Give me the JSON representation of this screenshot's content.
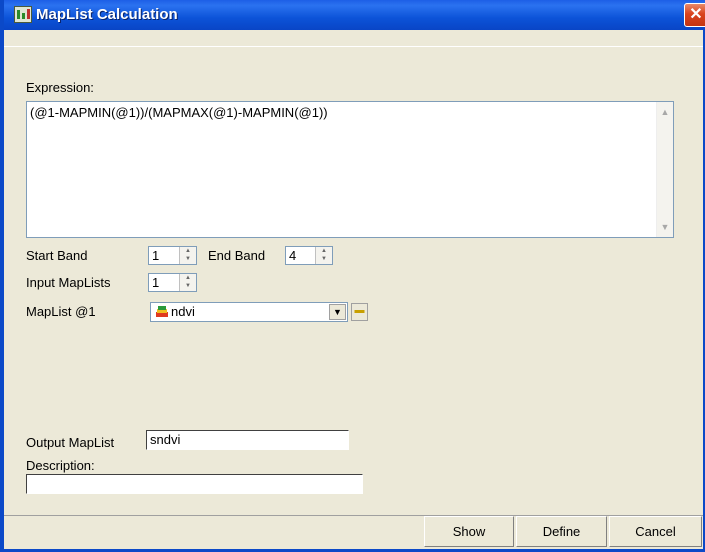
{
  "window": {
    "title": "MapList Calculation",
    "close_glyph": "✕"
  },
  "expression": {
    "label": "Expression:",
    "value": "(@1-MAPMIN(@1))/(MAPMAX(@1)-MAPMIN(@1))"
  },
  "bands": {
    "start_label": "Start Band",
    "start_value": "1",
    "end_label": "End Band",
    "end_value": "4"
  },
  "input_maplists": {
    "label": "Input MapLists",
    "value": "1"
  },
  "maplist1": {
    "label": "MapList @1",
    "value": "ndvi",
    "icon": "maplist-icon"
  },
  "output": {
    "label": "Output MapList",
    "value": "sndvi"
  },
  "description": {
    "label": "Description:",
    "value": ""
  },
  "buttons": {
    "show": "Show",
    "define": "Define",
    "cancel": "Cancel"
  },
  "colors": {
    "titlebar": "#0b5ad8",
    "dialog_bg": "#ece9d8",
    "close": "#d9431e"
  }
}
